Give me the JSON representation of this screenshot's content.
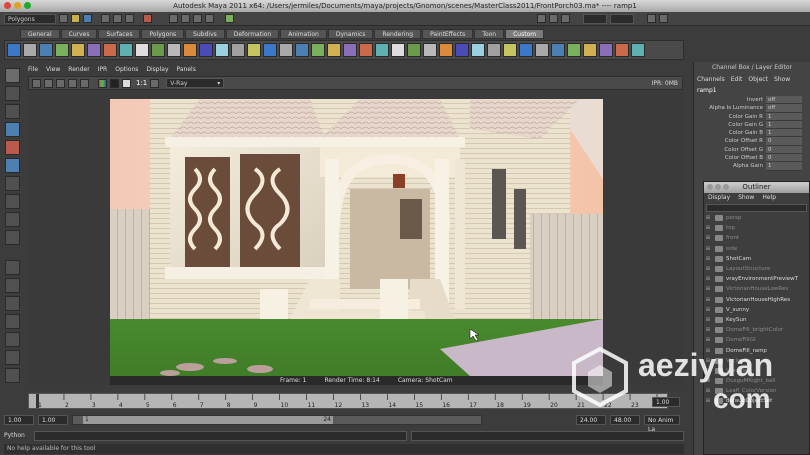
{
  "window": {
    "title": "Autodesk Maya 2011 x64: /Users/jermiles/Documents/maya/projects/Gnomon/scenes/MasterClass2011/FrontPorch03.ma*   ----   ramp1"
  },
  "toolbar": {
    "mode_menu": "Polygons"
  },
  "shelf_tabs": [
    "General",
    "Curves",
    "Surfaces",
    "Polygons",
    "Subdivs",
    "Deformation",
    "Animation",
    "Dynamics",
    "Rendering",
    "PaintEffects",
    "Toon",
    "Custom"
  ],
  "shelf_active": "Custom",
  "viewport": {
    "menu": [
      "File",
      "View",
      "Render",
      "IPR",
      "Options",
      "Display",
      "Panels"
    ],
    "ratio_label": "1:1",
    "renderer": "V-Ray",
    "ipr_label": "IPR: 0MB",
    "info": {
      "frame": "Frame: 1",
      "render_time": "Render Time: 8:14",
      "camera": "Camera: ShotCam"
    }
  },
  "time_slider": {
    "ticks": [
      "1",
      "2",
      "3",
      "4",
      "5",
      "6",
      "7",
      "8",
      "9",
      "10",
      "11",
      "12",
      "13",
      "14",
      "15",
      "16",
      "17",
      "18",
      "19",
      "20",
      "21",
      "22",
      "23",
      "24"
    ],
    "current": "1.00"
  },
  "range": {
    "start": "1.00",
    "start2": "1.00",
    "marker": "1",
    "end_marker": "24",
    "end": "24.00",
    "end2": "48.00",
    "anim_layer": "No Anim La"
  },
  "command": {
    "label": "Python"
  },
  "help_line": "No help available for this tool",
  "channel_box": {
    "header": "Channel Box / Layer Editor",
    "menu": [
      "Channels",
      "Edit",
      "Object",
      "Show"
    ],
    "node": "ramp1",
    "attrs": [
      {
        "name": "Invert",
        "value": "off"
      },
      {
        "name": "Alpha Is Luminance",
        "value": "off"
      },
      {
        "name": "Color Gain R",
        "value": "1"
      },
      {
        "name": "Color Gain G",
        "value": "1"
      },
      {
        "name": "Color Gain B",
        "value": "1"
      },
      {
        "name": "Color Offset R",
        "value": "0"
      },
      {
        "name": "Color Offset G",
        "value": "0"
      },
      {
        "name": "Color Offset B",
        "value": "0"
      },
      {
        "name": "Alpha Gain",
        "value": "1"
      }
    ]
  },
  "outliner": {
    "title": "Outliner",
    "menu": [
      "Display",
      "Show",
      "Help"
    ],
    "items": [
      {
        "label": "persp",
        "dim": true
      },
      {
        "label": "top",
        "dim": true
      },
      {
        "label": "front",
        "dim": true
      },
      {
        "label": "side",
        "dim": true
      },
      {
        "label": "ShotCam",
        "dim": false
      },
      {
        "label": "LayoutStructure",
        "dim": true
      },
      {
        "label": "vrayEnvironmentPreviewT",
        "dim": false
      },
      {
        "label": "VictorianHouseLowRes",
        "dim": true
      },
      {
        "label": "VictorianHouseHighRes",
        "dim": false
      },
      {
        "label": "V_sunny",
        "dim": false
      },
      {
        "label": "KeySun",
        "dim": false
      },
      {
        "label": "DomeFill_brightColor",
        "dim": true
      },
      {
        "label": "DomeFillGI",
        "dim": true
      },
      {
        "label": "DomeFill_ramp",
        "dim": false
      },
      {
        "label": "V_cloudy",
        "dim": true
      },
      {
        "label": "V_sunset",
        "dim": true
      },
      {
        "label": "DusguMRight_ball",
        "dim": true
      },
      {
        "label": "Leafl_ColorVersion",
        "dim": true
      },
      {
        "label": "defaultObjectSet",
        "dim": false
      }
    ]
  },
  "watermark": {
    "line1": "aeziyuan",
    "line2": "com"
  }
}
